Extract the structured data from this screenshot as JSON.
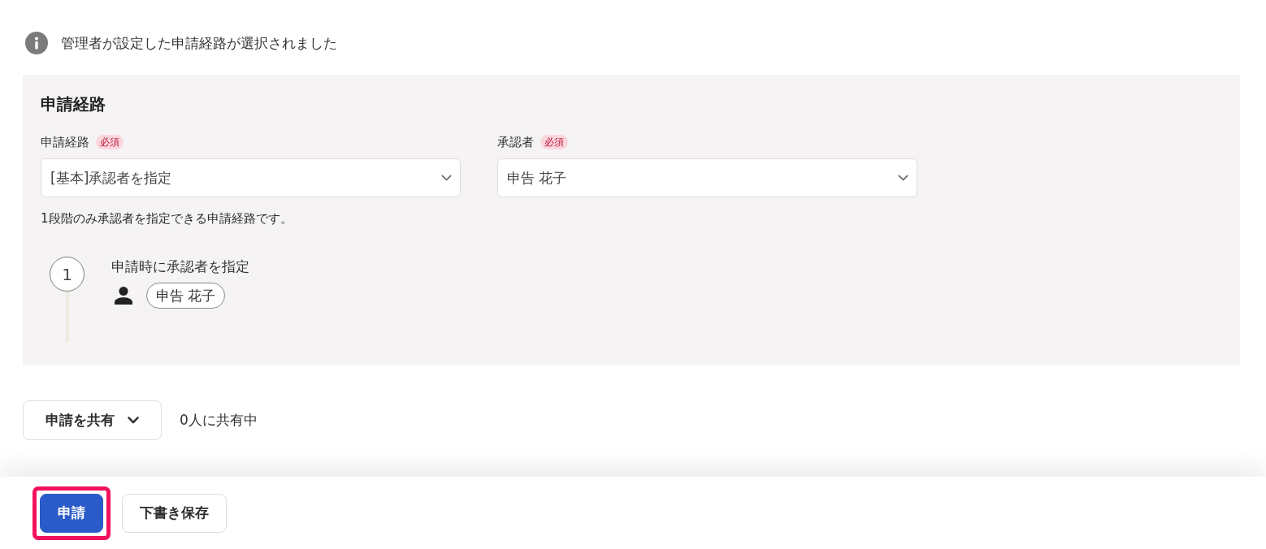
{
  "notice": {
    "text": "管理者が設定した申請経路が選択されました"
  },
  "route_panel": {
    "title": "申請経路",
    "fields": [
      {
        "label": "申請経路",
        "badge": "必須",
        "value": "[基本]承認者を指定"
      },
      {
        "label": "承認者",
        "badge": "必須",
        "value": "申告 花子"
      }
    ],
    "help_text": "1段階のみ承認者を指定できる申請経路です。",
    "steps": [
      {
        "number": "1",
        "title": "申請時に承認者を指定",
        "approvers": [
          "申告 花子"
        ]
      }
    ]
  },
  "share": {
    "button": "申請を共有",
    "status": "0人に共有中"
  },
  "footer": {
    "buttons": [
      {
        "label": "申請",
        "kind": "primary",
        "highlighted": true
      },
      {
        "label": "下書き保存",
        "kind": "secondary",
        "highlighted": false
      }
    ]
  }
}
